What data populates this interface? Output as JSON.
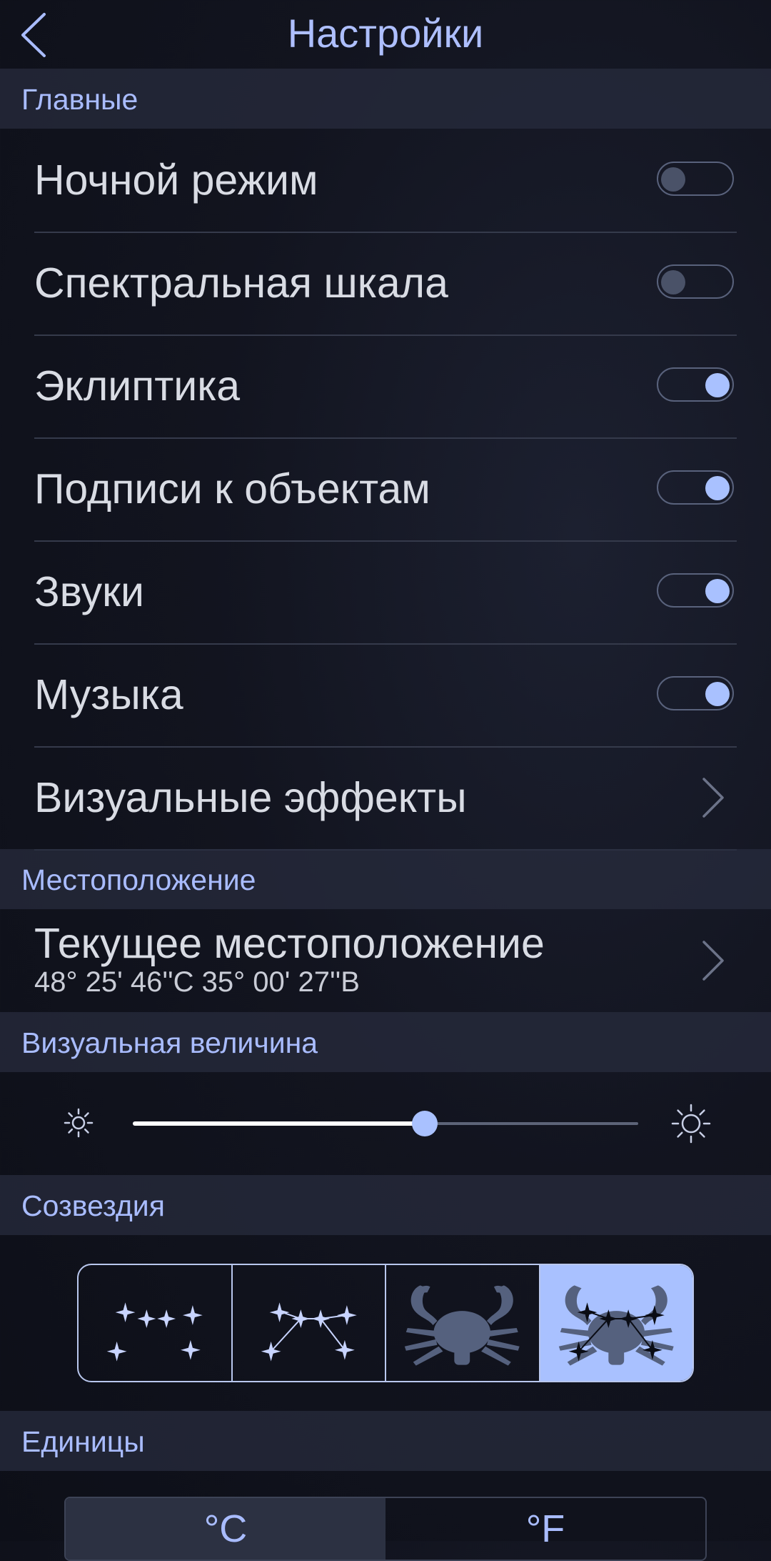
{
  "header": {
    "title": "Настройки",
    "back_icon": "chevron-left-icon"
  },
  "sections": {
    "main": "Главные",
    "location": "Местоположение",
    "magnitude": "Визуальная величина",
    "constellations": "Созвездия",
    "units": "Единицы"
  },
  "main_items": [
    {
      "label": "Ночной режим",
      "type": "toggle",
      "on": false
    },
    {
      "label": "Спектральная шкала",
      "type": "toggle",
      "on": false
    },
    {
      "label": "Эклиптика",
      "type": "toggle",
      "on": true
    },
    {
      "label": "Подписи к объектам",
      "type": "toggle",
      "on": true
    },
    {
      "label": "Звуки",
      "type": "toggle",
      "on": true
    },
    {
      "label": "Музыка",
      "type": "toggle",
      "on": true
    },
    {
      "label": "Визуальные эффекты",
      "type": "link"
    }
  ],
  "location": {
    "title": "Текущее местоположение",
    "coords": "48° 25' 46''С 35° 00' 27''В"
  },
  "magnitude": {
    "value_fraction": 0.577,
    "min_icon": "sun-small-icon",
    "max_icon": "sun-large-icon"
  },
  "constellations": {
    "options": [
      "stars-only",
      "stars-with-lines",
      "figure-only",
      "figure-with-stars"
    ],
    "selected_index": 3
  },
  "units": {
    "options": [
      "°C",
      "°F"
    ],
    "selected_index": 0
  },
  "colors": {
    "accent": "#a9c1ff",
    "section_bg": "#282d3e",
    "toggle_off_knob": "#4a5268",
    "divider": "#353a4b"
  }
}
